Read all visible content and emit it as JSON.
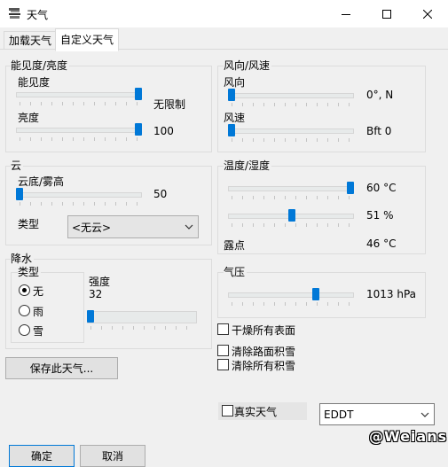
{
  "window": {
    "title": "天气",
    "minimize_label": "minimize",
    "maximize_label": "maximize",
    "close_label": "close"
  },
  "tabs": [
    {
      "label": "加载天气",
      "active": false
    },
    {
      "label": "自定义天气",
      "active": true
    }
  ],
  "visibility": {
    "group_title": "能见度/亮度",
    "visibility_label": "能见度",
    "visibility_value": "无限制",
    "visibility_level": 1.0,
    "brightness_label": "亮度",
    "brightness_value": "100",
    "brightness_level": 1.0
  },
  "wind": {
    "group_title": "风向/风速",
    "direction_label": "风向",
    "direction_value": "0°, N",
    "direction_level": 0.0,
    "speed_label": "风速",
    "speed_value": "Bft 0",
    "speed_level": 0.0
  },
  "cloud": {
    "group_title": "云",
    "base_label": "云底/雾高",
    "base_value": "50",
    "base_level": 0.0,
    "type_label": "类型",
    "type_selected": "<无云>"
  },
  "temperature": {
    "group_title": "温度/湿度",
    "temp_value": "60 °C",
    "temp_level": 1.0,
    "humidity_value": "51 %",
    "humidity_level": 0.51,
    "dewpoint_label": "露点",
    "dewpoint_value": "46 °C"
  },
  "precipitation": {
    "group_title": "降水",
    "type_label": "类型",
    "options": [
      {
        "label": "无",
        "checked": true
      },
      {
        "label": "雨",
        "checked": false
      },
      {
        "label": "雪",
        "checked": false
      }
    ],
    "intensity_label": "强度",
    "intensity_value": "32",
    "intensity_level": 0.0
  },
  "pressure": {
    "group_title": "气压",
    "value": "1013 hPa",
    "level": 0.71
  },
  "checkboxes": {
    "dry_surfaces": "干燥所有表面",
    "clear_road_snow": "清除路面积雪",
    "clear_all_snow": "清除所有积雪"
  },
  "save_button": "保存此天气...",
  "real_weather_label": "真实天气",
  "airport_selected": "EDDT",
  "ok_button": "确定",
  "cancel_button": "取消",
  "watermark": "@Weians"
}
